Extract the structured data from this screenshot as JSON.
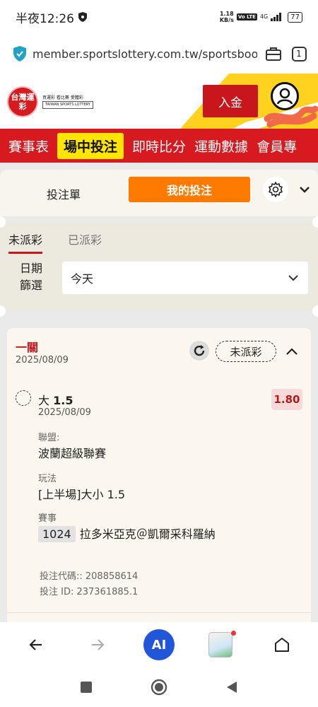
{
  "status_bar": {
    "time": "半夜12:26",
    "speed_value": "1.18",
    "speed_unit": "KB/s",
    "volte": "Vo LTE",
    "network": "4G",
    "battery": "77"
  },
  "browser": {
    "url": "member.sportslottery.com.tw/sportsbook/i",
    "tab_count": "1"
  },
  "header": {
    "logo_main": "台灣運彩",
    "logo_slogan": "買運彩 看比賽 愛體彩",
    "logo_sub": "TAIWAN SPORTS LOTTERY",
    "deposit_label": "入金"
  },
  "nav": {
    "items": [
      {
        "label": "賽事表",
        "active": false
      },
      {
        "label": "場中投注",
        "active": true
      },
      {
        "label": "即時比分",
        "active": false
      },
      {
        "label": "運動數據",
        "active": false
      },
      {
        "label": "會員專",
        "active": false
      }
    ]
  },
  "bet_tabs": {
    "slip_label": "投注單",
    "my_bets_label": "我的投注"
  },
  "status_tabs": {
    "unsettled": "未派彩",
    "settled": "已派彩"
  },
  "filter": {
    "label": "日期篩選",
    "selected": "今天"
  },
  "bet": {
    "type": "一關",
    "date": "2025/08/09",
    "status": "未派彩",
    "selection_prefix": "大",
    "selection_line": "1.5",
    "odds": "1.80",
    "selection_date": "2025/08/09",
    "league_label": "聯盟:",
    "league": "波蘭超級聯賽",
    "market_label": "玩法",
    "market": "[上半場]大小 1.5",
    "event_label": "賽事",
    "match_id": "1024",
    "match": "拉多米亞克＠凱爾采科羅納",
    "bet_code": "投注代碼:: 208858614",
    "bet_id": "投注 ID: 237361885.1"
  },
  "bottom_bar": {
    "ai_label": "AI"
  },
  "colors": {
    "brand_red": "#d71920",
    "highlight_yellow": "#ffe600",
    "accent_orange": "#ff7a00",
    "ai_blue": "#2156d9"
  }
}
